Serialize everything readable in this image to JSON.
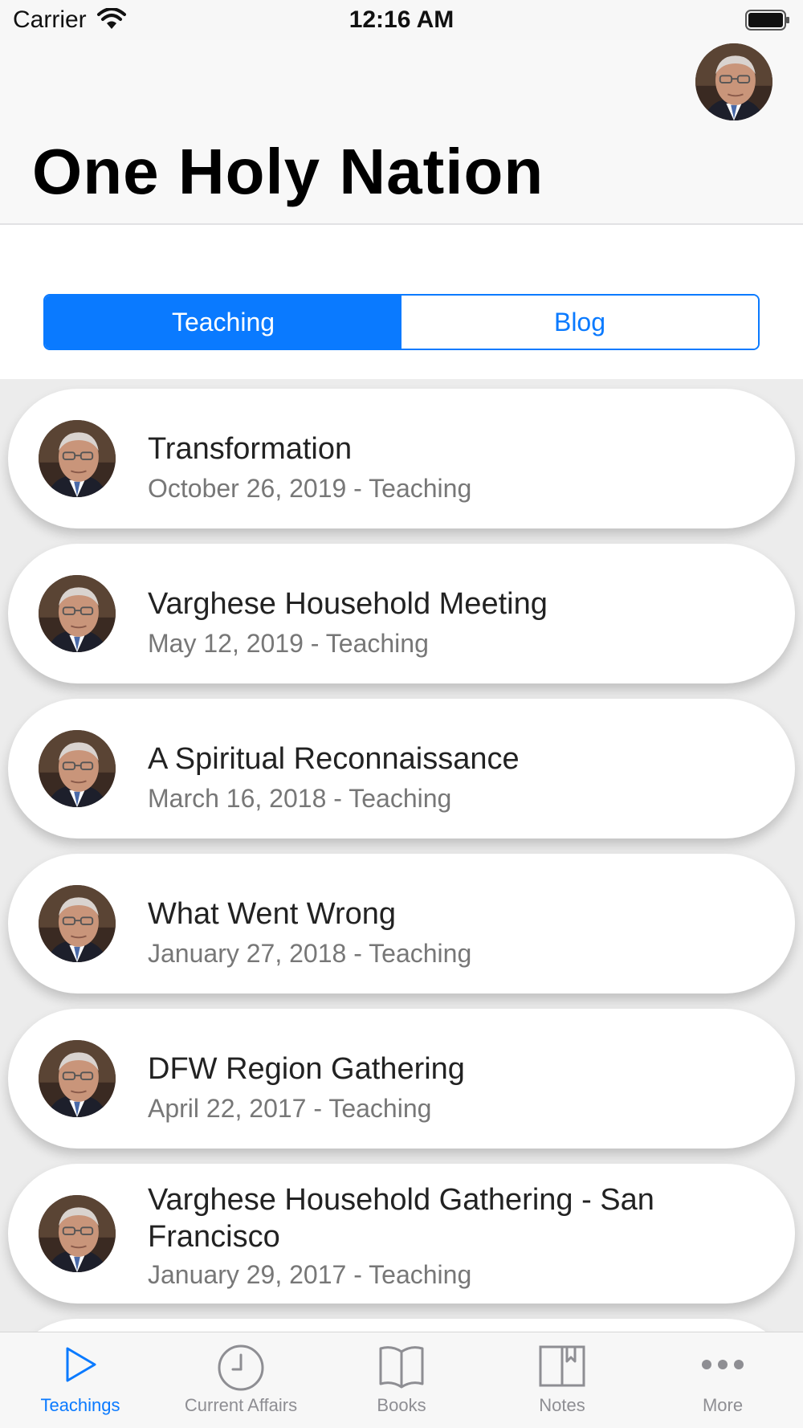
{
  "status_bar": {
    "carrier": "Carrier",
    "time": "12:16 AM"
  },
  "header": {
    "title": "One Holy Nation"
  },
  "segments": [
    {
      "label": "Teaching",
      "selected": true
    },
    {
      "label": "Blog",
      "selected": false
    }
  ],
  "items": [
    {
      "title": "Transformation",
      "subtitle": "October 26, 2019 - Teaching"
    },
    {
      "title": "Varghese Household Meeting",
      "subtitle": "May 12, 2019 - Teaching"
    },
    {
      "title": "A Spiritual Reconnaissance",
      "subtitle": "March 16, 2018 - Teaching"
    },
    {
      "title": "What Went Wrong",
      "subtitle": "January 27, 2018 - Teaching"
    },
    {
      "title": "DFW Region Gathering",
      "subtitle": "April 22, 2017 - Teaching"
    },
    {
      "title": "Varghese Household Gathering - San Francisco",
      "subtitle": "January 29, 2017 - Teaching"
    }
  ],
  "tabs": [
    {
      "label": "Teachings",
      "icon": "play-icon",
      "active": true
    },
    {
      "label": "Current Affairs",
      "icon": "clock-icon",
      "active": false
    },
    {
      "label": "Books",
      "icon": "book-icon",
      "active": false
    },
    {
      "label": "Notes",
      "icon": "notes-icon",
      "active": false
    },
    {
      "label": "More",
      "icon": "more-icon",
      "active": false
    }
  ],
  "colors": {
    "accent": "#0a7aff",
    "secondary_text": "#777777",
    "list_background": "#ececec"
  }
}
